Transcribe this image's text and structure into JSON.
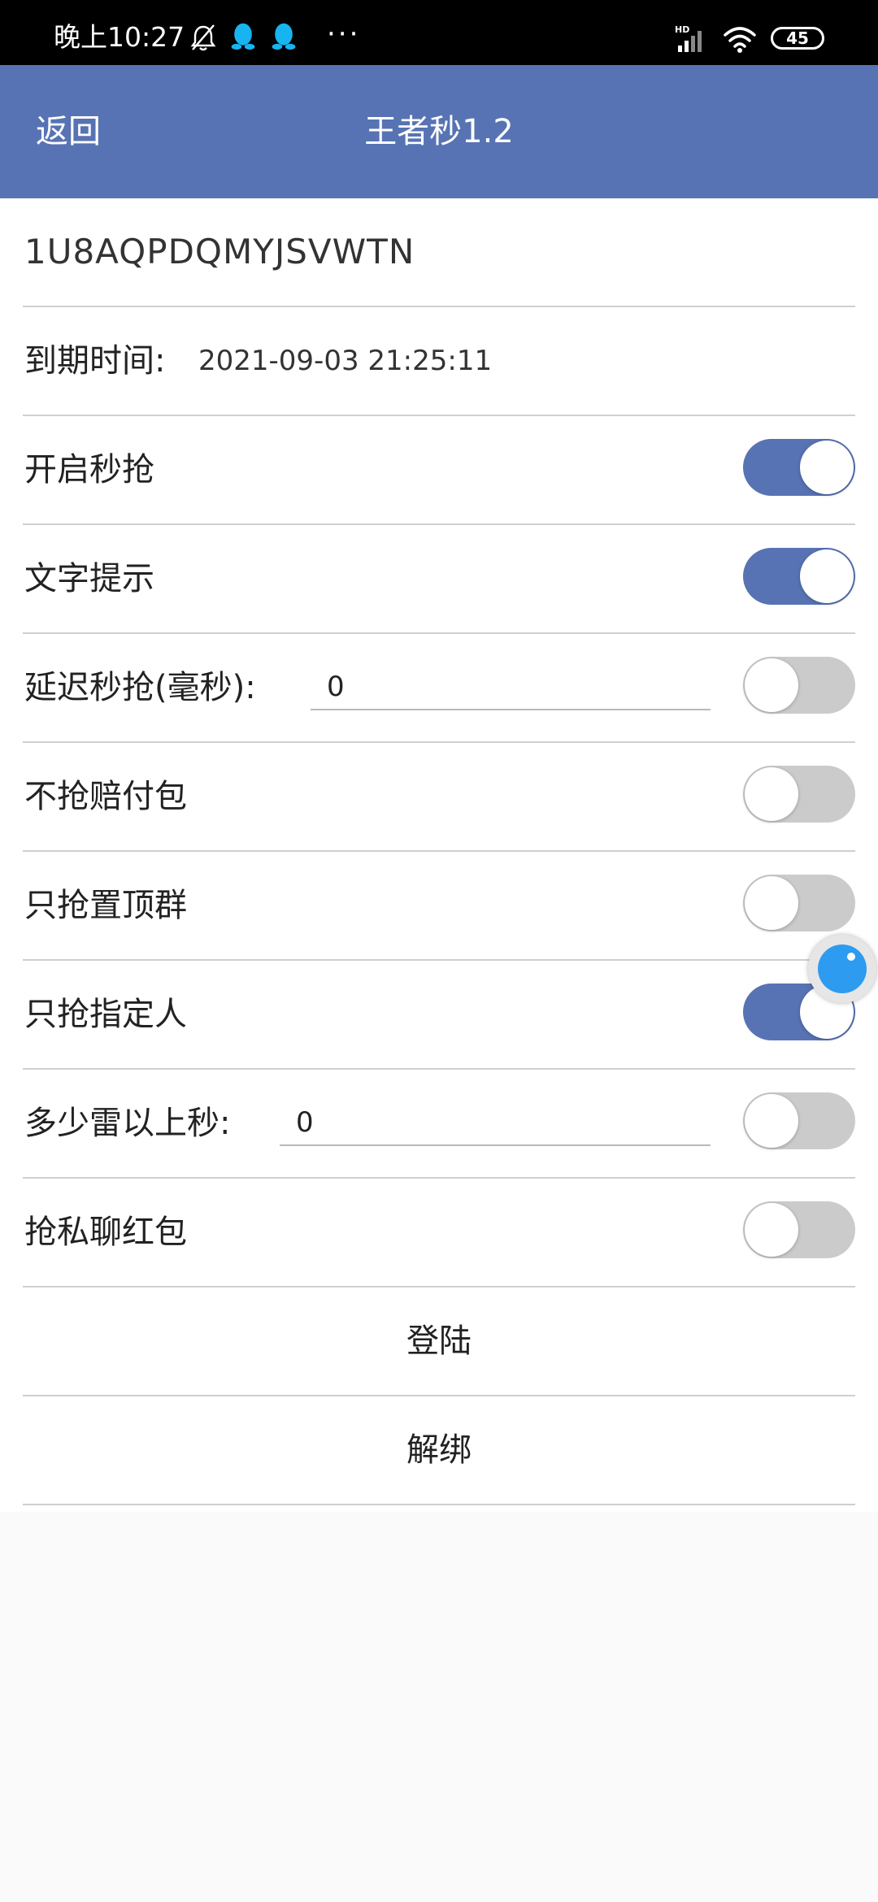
{
  "status_bar": {
    "time": "晚上10:27",
    "more": "···",
    "battery": "45",
    "icons": [
      "mute-bell-icon",
      "qq-penguin-icon",
      "qq-penguin-icon",
      "hd-signal-icon",
      "wifi-icon",
      "battery-icon"
    ]
  },
  "header": {
    "back_label": "返回",
    "title": "王者秒1.2",
    "color": "#5773b3"
  },
  "code": "1U8AQPDQMYJSVWTN",
  "expiry": {
    "label": "到期时间:",
    "value": "2021-09-03 21:25:11"
  },
  "settings": [
    {
      "label": "开启秒抢",
      "on": true
    },
    {
      "label": "文字提示",
      "on": true
    },
    {
      "label": "延迟秒抢(毫秒):",
      "input": "0",
      "on": false
    },
    {
      "label": "不抢赔付包",
      "on": false
    },
    {
      "label": "只抢置顶群",
      "on": false
    },
    {
      "label": "只抢指定人",
      "on": true
    },
    {
      "label": "多少雷以上秒:",
      "input": "0",
      "on": false
    },
    {
      "label": "抢私聊红包",
      "on": false
    }
  ],
  "actions": {
    "login": "登陆",
    "unbind": "解绑"
  },
  "colors": {
    "toggle_on": "#5773b3",
    "toggle_off": "#cbcbcb",
    "bubble": "#2d9bf0"
  }
}
